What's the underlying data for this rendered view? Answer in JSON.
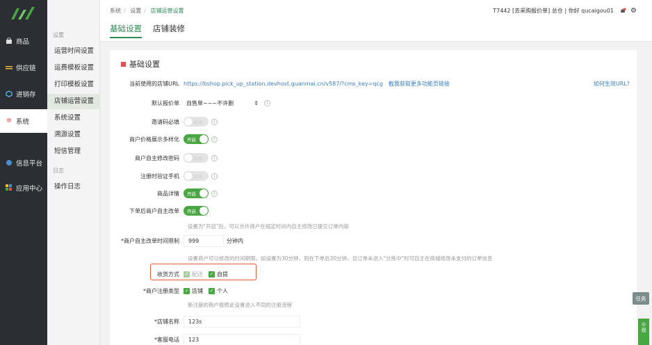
{
  "sidebar": {
    "items": [
      {
        "label": "商品",
        "icon": "shopping-bag-icon"
      },
      {
        "label": "供应链",
        "icon": "list-icon"
      },
      {
        "label": "进销存",
        "icon": "inventory-icon"
      },
      {
        "label": "系统",
        "icon": "gear-icon"
      },
      {
        "label": "信息平台",
        "icon": "globe-icon"
      },
      {
        "label": "应用中心",
        "icon": "apps-grid-icon"
      }
    ]
  },
  "submenu": {
    "group_settings": "设置",
    "group_log": "日志",
    "items": [
      {
        "label": "运营时间设置"
      },
      {
        "label": "运费模板设置"
      },
      {
        "label": "打印模板设置"
      },
      {
        "label": "店铺运营设置"
      },
      {
        "label": "系统设置"
      },
      {
        "label": "溯源设置"
      },
      {
        "label": "短信管理"
      }
    ],
    "log_items": [
      {
        "label": "操作日志"
      }
    ]
  },
  "header": {
    "breadcrumb": [
      "系统",
      "设置",
      "店铺运营设置"
    ],
    "tabs": [
      {
        "label": "基础设置"
      },
      {
        "label": "店铺装修"
      }
    ],
    "user_text": "T7442 [去采购报价单] 总仓 | 你好 qucaigou01"
  },
  "main": {
    "section_title": "基础设置",
    "store_url_label": "当前使用的店铺URL",
    "store_url": "https://bshop.pick_up_station.devhost.guanmai.cn/v587/?cms_key=qcg",
    "more_link": "截我获取更多功能页链接",
    "how_link": "如何生效URL?",
    "default_price_label": "默认报价单",
    "default_price_value": "自售单~~~不许删",
    "invite_label": "邀请码必填",
    "price_diverse_label": "商户价格展示多样化",
    "self_pwd_label": "商户自主修改密码",
    "phone_verify_label": "注册时验证手机",
    "product_detail_label": "商品详情",
    "self_modify_label": "下单后商户自主改单",
    "self_modify_hint": "设置为\"开启\"后，可以允许商户在规定时间内自主修改已提交订单内容",
    "time_limit_label": "*商户自主改单时间限制",
    "time_limit_value": "999",
    "time_limit_unit": "分钟内",
    "time_limit_hint": "设置商户可以修改的时间期限，如设置为30分钟，则在下单后30分钟，且订单未进入\"分拣中\"时可自主在商城修改未支付的订单信息",
    "receive_label": "收货方式",
    "receive_options": [
      "配送",
      "自提"
    ],
    "register_type_label": "*商户注册类型",
    "register_type_options": [
      "店铺",
      "个人"
    ],
    "register_type_hint": "新注册的商户按照此设置进入不同的注册流程",
    "store_name_label": "*店铺名称",
    "store_name_value": "123s",
    "service_phone_label": "*客服电话",
    "service_phone_value": "123",
    "toggle_on_text": "开启",
    "toggle_off_text": "关闭"
  },
  "floating": {
    "task_label": "任务",
    "side_label": "观"
  },
  "colors": {
    "accent": "#2e8b57",
    "toggle_on": "#49a642",
    "highlight_border": "#e35a2c",
    "sidebar_bg": "#2b2f33"
  }
}
